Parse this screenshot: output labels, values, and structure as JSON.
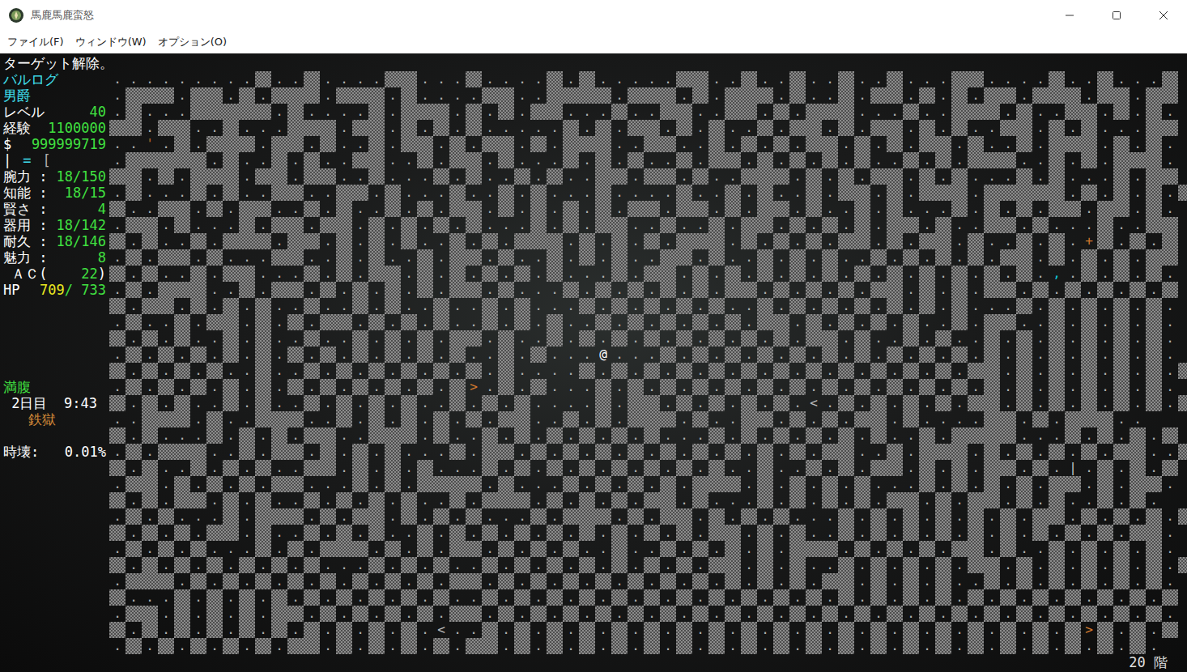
{
  "window": {
    "title": "馬鹿馬鹿蛮怒"
  },
  "menu": [
    {
      "label": "ファイル(F)"
    },
    {
      "label": "ウィンドウ(W)"
    },
    {
      "label": "オプション(O)"
    }
  ],
  "message": "ターゲット解除。",
  "sidebar": {
    "groups": [
      {
        "lines": [
          {
            "left": [
              {
                "text": "バルログ",
                "color": "#40e0f0"
              }
            ],
            "right": []
          },
          {
            "left": [
              {
                "text": "男爵",
                "color": "#40e0f0"
              }
            ],
            "right": []
          },
          {
            "left": [
              {
                "text": "レベル",
                "color": "#ffffff"
              }
            ],
            "right": [
              {
                "text": "40",
                "color": "#40e040"
              }
            ]
          },
          {
            "left": [
              {
                "text": "経験",
                "color": "#ffffff"
              }
            ],
            "right": [
              {
                "text": "1100000",
                "color": "#40e040"
              }
            ]
          },
          {
            "left": [
              {
                "text": "$",
                "color": "#ffffff"
              }
            ],
            "right": [
              {
                "text": "999999719",
                "color": "#40e040"
              }
            ]
          },
          {
            "left": [
              {
                "text": "|",
                "color": "#ffffff"
              },
              {
                "text": "=",
                "color": "#40e0f0"
              },
              {
                "text": "[",
                "color": "#b0b0b0"
              }
            ],
            "right": []
          },
          {
            "left": [
              {
                "text": "腕力 :",
                "color": "#ffffff"
              }
            ],
            "right": [
              {
                "text": "18/150",
                "color": "#40e040"
              }
            ]
          },
          {
            "left": [
              {
                "text": "知能 :",
                "color": "#ffffff"
              }
            ],
            "right": [
              {
                "text": "18/15",
                "color": "#40e040"
              }
            ]
          },
          {
            "left": [
              {
                "text": "賢さ :",
                "color": "#ffffff"
              }
            ],
            "right": [
              {
                "text": "4",
                "color": "#40e040"
              }
            ]
          },
          {
            "left": [
              {
                "text": "器用 :",
                "color": "#ffffff"
              }
            ],
            "right": [
              {
                "text": "18/142",
                "color": "#40e040"
              }
            ]
          },
          {
            "left": [
              {
                "text": "耐久 :",
                "color": "#ffffff"
              }
            ],
            "right": [
              {
                "text": "18/146",
                "color": "#40e040"
              }
            ]
          },
          {
            "left": [
              {
                "text": "魅力 :",
                "color": "#ffffff"
              }
            ],
            "right": [
              {
                "text": "8",
                "color": "#40e040"
              }
            ]
          },
          {
            "left": [
              {
                "text": " ＡＣ(",
                "color": "#ffffff"
              }
            ],
            "right": [
              {
                "text": "22",
                "color": "#40e040"
              },
              {
                "text": ")",
                "color": "#ffffff"
              }
            ]
          },
          {
            "left": [
              {
                "text": "HP",
                "color": "#ffffff"
              }
            ],
            "right": [
              {
                "text": "709",
                "color": "#e8e820"
              },
              {
                "text": "/ 733",
                "color": "#40e040"
              }
            ]
          }
        ]
      },
      {
        "lines": [
          {
            "left": [
              {
                "text": "満腹",
                "color": "#40e040"
              }
            ],
            "right": []
          },
          {
            "left": [
              {
                "text": " 2日目  9:43",
                "color": "#ffffff"
              }
            ],
            "right": []
          },
          {
            "left": [
              {
                "text": "   鉄獄",
                "color": "#d08838"
              }
            ],
            "right": []
          }
        ]
      },
      {
        "lines": [
          {
            "left": [
              {
                "text": "時壊:",
                "color": "#ffffff"
              }
            ],
            "right": [
              {
                "text": "0.01%",
                "color": "#ffffff"
              }
            ]
          }
        ]
      }
    ]
  },
  "map": {
    "wall": "#",
    "glyphs": [
      {
        "char": "@",
        "color": "#ffffff"
      },
      {
        "char": ">",
        "color": "#d2782e"
      },
      {
        "char": "<",
        "color": "#b8b8b8"
      },
      {
        "char": "+",
        "color": "#d2782e"
      },
      {
        "char": ",",
        "color": "#10c8d8"
      },
      {
        "char": "'",
        "color": "#b8662a"
      },
      {
        "char": "|",
        "color": "#c8c8c8"
      },
      {
        "char": ".",
        "color": "#b4b4b4"
      }
    ],
    "rows": [
      ".........#..#....##...#....#.#.....##..#..#..#..#...##....#..#...#",
      ".###.##.#.###.###.#....##..####.###.#.###.#..#.##.#.#.##.###.##.##",
      ".#...#####.#....#.###.#.#.##...#..##..##.#.###...#..###.#..##.#.#.",
      "##.##..#...###.##.#.#.#.....#.#.##.#.#..#.##.#.##.#.#..##.#.#...##",
      "..'.#.###.##.#..#.##.#.##.#.###..##..#.#.#.##.#.#.##.#..#.###.#.#.",
      ".#####.#..#.#..##..#.##.#...#.#.#..#.##.#.#.#.#..#.#.###..#.#.###.",
      "##.#.###.##.##..#...#.#..#.#..##.##.#..###.#.#.##.#.#...#.#...#.##",
      ".#...#.#..##..##.#...#..#.#...#....#..#.#..#.##.#.###.#####.#.#.#.#",
      "#..##.#.##..#.#..#.#.##.#.#.#.#.##.##.#.##.#..#.#...#.#.#.##.##.#.",
      ".##.#...#.##.##.#.#.#.#...#.#.##..#..#.##.#.#.#.##.#..##.#...#..##",
      "#.#..#.###.##.#.#.#..#.#.###.#.#.#.###.#.#.#.##.#.##.#..#.#.+#.#.#",
      ".#.##.#...##..#.#..#.##.#..#.#.#..##.#..#.#.#..#.#.#.#.##.#.#.#.##",
      "#.#..#.##...#.#.##.#.#.#.#.#...#.##.#.#.#.#.#.#.#.#.#.#.#.,.#.#.#.",
      ".#.###..#.##.#.#.#.#.##.#...#.#.#.#.#.##.#.#.#.##.#.#.##.#.#.#.#.#",
      "#.##.#.#.#..#..#.#..#..#.#...#.#.#.#.#..#.#.#.#.#.#.#...#.#.#.#.#.",
      ".#..#.##.#.#.##.#.#.#..#.#.#..#.#.#.#.#.##.#.#.#.#..#.##..#.#.#.#.",
      "#.#.#..#.#..#..#.#.#.##.#..#.#.#.#.#.#.#.#.##.#..#.#..#.#.#.#.#.#.",
      ".#.#.#.#.#.#.#.#.#.#.#..#.#...@...#.#.#.#.#.#.#.#.#.#.#.#.#.#.#.#.",
      "#.#.#.#..#..#.#.#.#.#.#.#....#.#.#.#.#.#.#.#.#.#.#.#.##.#.#.#.#.#.#",
      ".#.#.#.#.#.#.#.#.#.#.#>.#.#...#.#.#.#.#.#.#.#.#.#.#.#.#.#.#.#.#.#.",
      "#.#.#..#.#..#.#.#.#..#.#.#....#.##.#.#.#.#.<.#.#.#.#.##.#.#.#.#.#.#",
      "..###.#..###..#.#.#.#.#.##..#.#.###.#..##.#.#.##.#....##.#.###..",
      "#.#...#.#.#.##..###.#..#.#.#.#.#.#...#.#.#.#.#.#..#.####...#.#.#.#",
      ".#.###..#.##.#.#.#...#.##.#.#.#.#.#.#.#.#.#.##..#.###.#.#.#.#.##..#.",
      "#.#..#.#.#..##.#.#.#...#.#.#.#.#.#.#.#..#..#.#.##.#.#.##.#.|.#.#.#",
      ".##.#.#.#.##...#.#.####.#...#.#.#.#.###.#.#.#.#...#.#.#.#.##.#.##.",
      "#.#.##.#.#..#.#.#.#..#.###.#.#.#.##.#...#.#.#.#.##.#.##.#.#..#.#.",
      ".#.#...#.###.#.##.#.#.#...#.###.#.##.#.#.#...#.#.#.#.#.#.##.#.#.#.#",
      "#.#.#.##.#..#.#.#..#.#.#.#.#.#.#.#.#.##.#.#..#.#.#.#.#.#.#.#.#.##.",
      ".#.#.#...#.#.###.#.#.##.#.#.#..#..#.#.#.#.###.#.#.#.##.#..#.#.#.#.",
      "#.#.#.#.#.#.#...#.#.#..#.#.#.#.#.#.#.##.#.#..#.#.#.#.##.#.#.#.#.#.#",
      ".###.#.#.#.#.#.#.#.#.##.#.#.#.#.#.#.#.#.#.#.##.#.#.#..#.#.#.#.#.#.",
      "#...#.#.#.#.#.#.#.#.#..#.#.#.#.#.#.#.#.#.#.#.#.#.#.#.#.#.#.#.#.#.#",
      ".##.#.#.#.##.#.#.#.#.##.#.#.#.#.#.#.#.#.#.#.#.#.#.#.#.#.#.#.#.#.#.",
      "#.#.#.#.#.#.#.#.#.#.<..#.#.#.#.#.#.#.#.#.#.#.#.#.#.#.#.#.#.#>#.#.#",
      ".#.#.#.#.#.##.#.#.#.#.##.#.#.#.#.#.#.#.#.#.#.#.#.#.#.#.#.#.#.#.#."
    ]
  },
  "footer": {
    "depth": "20 階"
  }
}
